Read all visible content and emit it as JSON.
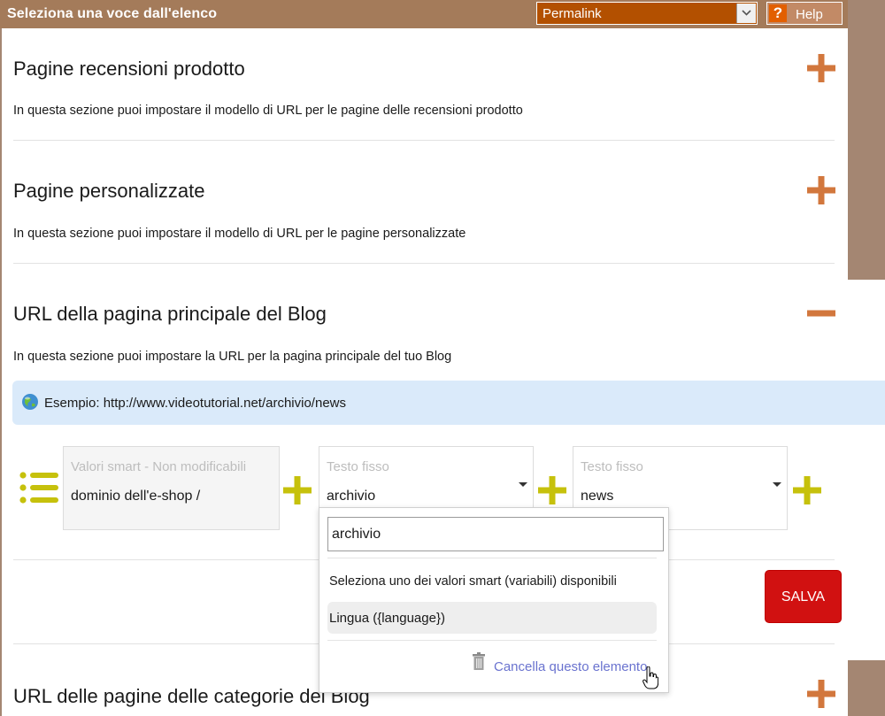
{
  "header": {
    "title": "Seleziona una voce dall'elenco",
    "select_value": "Permalink",
    "help_label": "Help",
    "help_glyph": "?"
  },
  "sections": [
    {
      "title": "Pagine recensioni prodotto",
      "description": "In questa sezione puoi impostare il modello di URL per le pagine delle recensioni prodotto",
      "state": "collapsed"
    },
    {
      "title": "Pagine personalizzate",
      "description": "In questa sezione puoi impostare il modello di URL per le pagine personalizzate",
      "state": "collapsed"
    },
    {
      "title": "URL della pagina principale del Blog",
      "description": "In questa sezione puoi impostare la URL per la pagina principale del tuo Blog",
      "state": "expanded"
    },
    {
      "title": "URL delle pagine delle categorie del Blog",
      "state": "collapsed"
    }
  ],
  "example": {
    "text": "Esempio: http://www.videotutorial.net/archivio/news"
  },
  "url_builder": {
    "fields": [
      {
        "label": "Valori smart - Non modificabili",
        "value": "dominio dell'e-shop /"
      },
      {
        "label": "Testo fisso",
        "value": "archivio"
      },
      {
        "label": "Testo fisso",
        "value": "news"
      }
    ]
  },
  "dropdown": {
    "input_value": "archivio",
    "hint": "Seleziona uno dei valori smart (variabili) disponibili",
    "options": [
      "Lingua ({language})"
    ],
    "delete_label": "Cancella questo elemento"
  },
  "save_label": "SALVA",
  "colors": {
    "header_bg": "#a47b5a",
    "accent_orange": "#d2773d",
    "accent_lime": "#c6c10c",
    "save_red": "#d11111",
    "example_bg": "#daeafa",
    "link": "#6a73cf"
  }
}
